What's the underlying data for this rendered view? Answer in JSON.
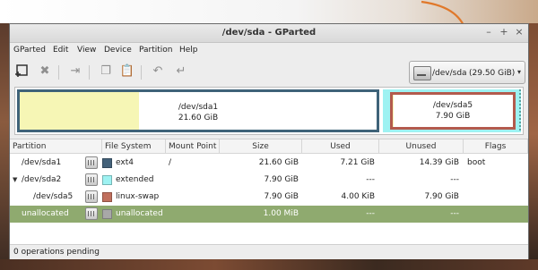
{
  "window": {
    "title": "/dev/sda - GParted",
    "controls": {
      "minimize": "–",
      "maximize": "+",
      "close": "×"
    }
  },
  "menu": [
    "GParted",
    "Edit",
    "View",
    "Device",
    "Partition",
    "Help"
  ],
  "toolbar": {
    "icons": [
      "new-partition-icon",
      "delete-icon",
      "resize-move-icon",
      "copy-icon",
      "paste-icon",
      "undo-icon",
      "apply-icon"
    ]
  },
  "device_selector": {
    "device": "/dev/sda",
    "size": "(29.50 GiB)",
    "arrow": "▾"
  },
  "disk_map": {
    "sda1": {
      "name": "/dev/sda1",
      "size": "21.60 GiB",
      "used_fraction": 0.334,
      "color": "#3f6379"
    },
    "sda2": {
      "color": "#9ef2f2"
    },
    "sda5": {
      "name": "/dev/sda5",
      "size": "7.90 GiB",
      "used_fraction": 0.0005,
      "color": "#b35a4d"
    }
  },
  "table": {
    "headers": [
      "Partition",
      "File System",
      "Mount Point",
      "Size",
      "Used",
      "Unused",
      "Flags"
    ],
    "rows": [
      {
        "partition": "/dev/sda1",
        "filesystem": "ext4",
        "fs_color": "#44627a",
        "mount": "/",
        "size": "21.60 GiB",
        "used": "7.21 GiB",
        "unused": "14.39 GiB",
        "flags": "boot",
        "expander": "",
        "selected": false
      },
      {
        "partition": "/dev/sda2",
        "filesystem": "extended",
        "fs_color": "#9ef2f2",
        "mount": "",
        "size": "7.90 GiB",
        "used": "---",
        "unused": "---",
        "flags": "",
        "expander": "▼",
        "selected": false
      },
      {
        "partition": "/dev/sda5",
        "filesystem": "linux-swap",
        "fs_color": "#c06f5d",
        "mount": "",
        "size": "7.90 GiB",
        "used": "4.00 KiB",
        "unused": "7.90 GiB",
        "flags": "",
        "expander": "",
        "selected": false
      },
      {
        "partition": "unallocated",
        "filesystem": "unallocated",
        "fs_color": "#a8a8a8",
        "mount": "",
        "size": "1.00 MiB",
        "used": "---",
        "unused": "---",
        "flags": "",
        "expander": "",
        "selected": true
      }
    ]
  },
  "status": "0 operations pending",
  "colors": {
    "selection": "#8faa6f",
    "arrow": "#e0782a"
  }
}
